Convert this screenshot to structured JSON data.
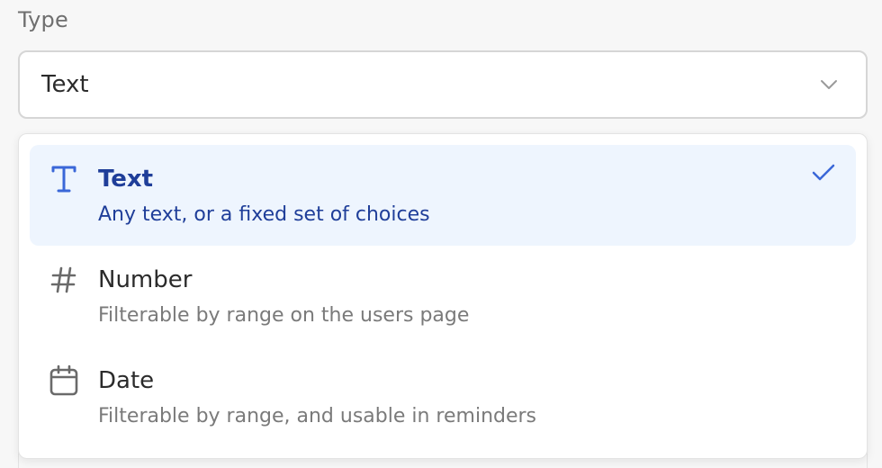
{
  "field": {
    "label": "Type",
    "selected_value": "Text"
  },
  "options": [
    {
      "title": "Text",
      "description": "Any text, or a fixed set of choices",
      "icon": "text-type-icon",
      "selected": true
    },
    {
      "title": "Number",
      "description": "Filterable by range on the users page",
      "icon": "hash-icon",
      "selected": false
    },
    {
      "title": "Date",
      "description": "Filterable by range, and usable in reminders",
      "icon": "calendar-icon",
      "selected": false
    }
  ],
  "colors": {
    "accent": "#3a67d8",
    "selected_bg": "#eef5fe",
    "selected_text": "#1f3e99",
    "muted_text": "#7a7a7a"
  }
}
